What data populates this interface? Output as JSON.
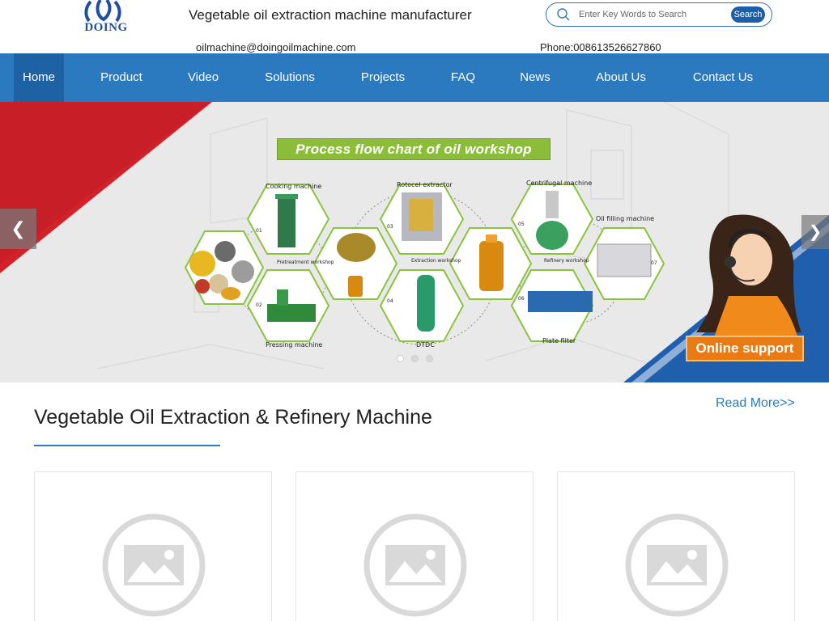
{
  "header": {
    "logo_text": "DOING",
    "site_title": "Vegetable oil extraction machine manufacturer",
    "email": "oilmachine@doingoilmachine.com",
    "phone": "Phone:008613526627860",
    "search": {
      "placeholder": "Enter Key Words to Search",
      "button_label": "Search"
    }
  },
  "nav": {
    "items": [
      {
        "label": "Home",
        "active": true
      },
      {
        "label": "Product"
      },
      {
        "label": "Video"
      },
      {
        "label": "Solutions"
      },
      {
        "label": "Projects"
      },
      {
        "label": "FAQ"
      },
      {
        "label": "News"
      },
      {
        "label": "About Us"
      },
      {
        "label": "Contact Us"
      }
    ]
  },
  "banner": {
    "title": "Process flow chart of oil workshop",
    "labels": {
      "cooking": "Cooking machine",
      "rotocel": "Rotocel extractor",
      "centrifugal": "Centrifugal machine",
      "oil_filling": "Oil filling machine",
      "pretreatment": "Pretreatment workshop",
      "extraction": "Extraction workshop",
      "refinery": "Refinery workshop",
      "pressing": "Pressing machine",
      "dtdc": "DTDC",
      "plate_filter": "Plate filter"
    },
    "step_numbers": [
      "01",
      "02",
      "03",
      "04",
      "05",
      "06",
      "07"
    ],
    "slide_count": 3,
    "active_slide": 1,
    "online_support": "Online support"
  },
  "section": {
    "title": "Vegetable Oil Extraction & Refinery Machine",
    "read_more": "Read More>>"
  },
  "colors": {
    "brand_blue": "#2b7ac0",
    "nav_active": "#1f62a4",
    "banner_red": "#d3212a",
    "banner_green": "#8bbd3a",
    "support_orange": "#ea7a14"
  }
}
